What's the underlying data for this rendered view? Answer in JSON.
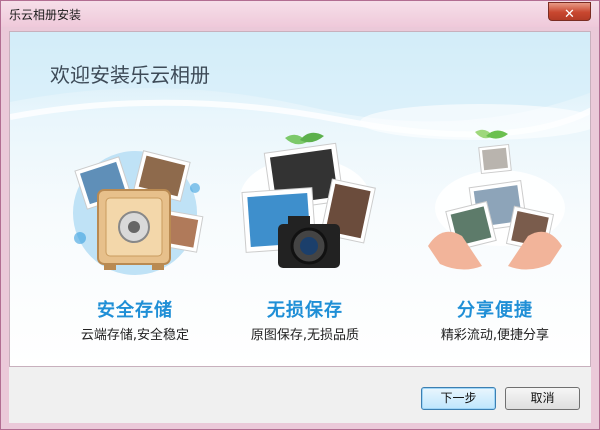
{
  "window": {
    "title": "乐云相册安装",
    "close_glyph": "✕"
  },
  "main": {
    "heading": "欢迎安装乐云相册"
  },
  "features": [
    {
      "title": "安全存储",
      "subtitle": "云端存储,安全稳定",
      "icon": "safe-icon"
    },
    {
      "title": "无损保存",
      "subtitle": "原图保存,无损品质",
      "icon": "camera-icon"
    },
    {
      "title": "分享便捷",
      "subtitle": "精彩流动,便捷分享",
      "icon": "hands-photos-icon"
    }
  ],
  "footer": {
    "next_label": "下一步",
    "cancel_label": "取消"
  },
  "colors": {
    "accent": "#1f8fd6",
    "titlebar": "#efc9da",
    "close": "#c8472f"
  }
}
